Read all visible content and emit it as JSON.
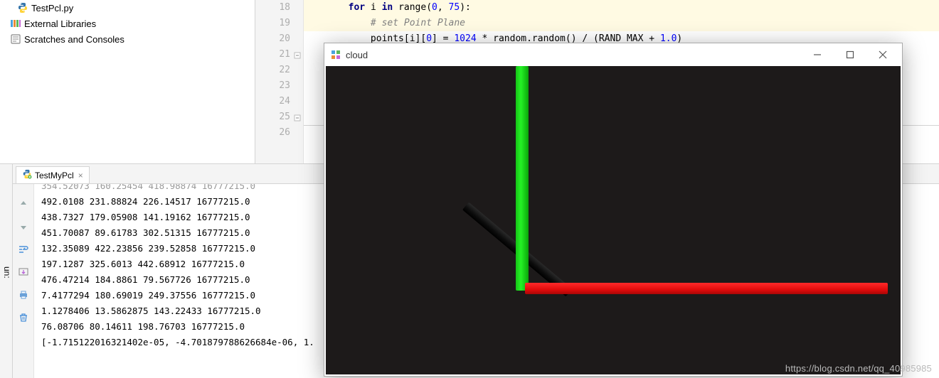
{
  "project": {
    "file_name": "TestPcl.py",
    "ext_libs_label": "External Libraries",
    "scratches_label": "Scratches and Consoles"
  },
  "editor": {
    "line_numbers": [
      "18",
      "19",
      "20",
      "21",
      "22",
      "23",
      "24",
      "25",
      "26"
    ],
    "code": {
      "l18_pre": "        ",
      "l18_for": "for",
      "l18_sp1": " ",
      "l18_i": "i",
      "l18_sp2": " ",
      "l18_in": "in",
      "l18_sp3": " ",
      "l18_range": "range",
      "l18_paren_open": "(",
      "l18_zero": "0",
      "l18_comma": ", ",
      "l18_end": "75",
      "l18_paren_close": "):",
      "l19_indent": "            ",
      "l19_comment": "# set Point Plane",
      "l20_indent": "            ",
      "l20_code_a": "points[i][",
      "l20_zero": "0",
      "l20_code_b": "] = ",
      "l20_n1": "1024",
      "l20_code_c": " * random.random() / (RAND_MAX + ",
      "l20_n2": "1.0",
      "l20_code_d": ")"
    }
  },
  "run": {
    "label": "un:",
    "tab_label": "TestMyPcl",
    "rows": [
      "354.52073 160.25454 418.98874 16777215.0",
      "492.0108 231.88824 226.14517 16777215.0",
      "438.7327 179.05908 141.19162 16777215.0",
      "451.70087 89.61783 302.51315 16777215.0",
      "132.35089 422.23856 239.52858 16777215.0",
      "197.1287 325.6013 442.68912 16777215.0",
      "476.47214 184.8861 79.567726 16777215.0",
      "7.4177294 180.69019 249.37556 16777215.0",
      "1.1278406 13.5862875 143.22433 16777215.0",
      "76.08706 80.14611 198.76703 16777215.0",
      "[-1.715122016321402e-05, -4.701879788626684e-06, 1."
    ]
  },
  "cloud": {
    "title": "cloud"
  },
  "watermark": "https://blog.csdn.net/qq_40985985"
}
